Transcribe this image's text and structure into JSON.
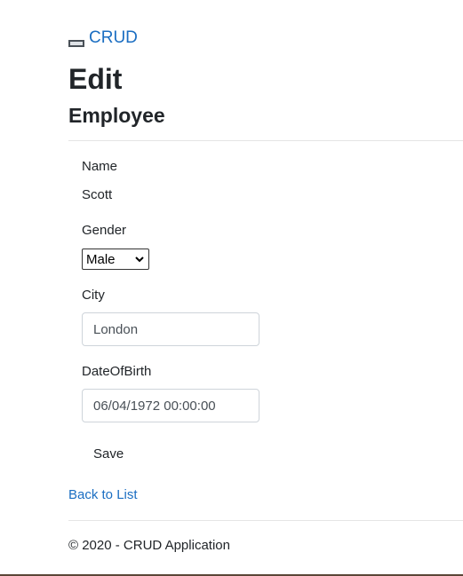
{
  "header": {
    "brand_text": "CRUD"
  },
  "page": {
    "title": "Edit",
    "subtitle": "Employee"
  },
  "form": {
    "name_label": "Name",
    "name_value": "Scott",
    "gender_label": "Gender",
    "gender_selected": "Male",
    "city_label": "City",
    "city_value": "London",
    "dob_label": "DateOfBirth",
    "dob_value": "06/04/1972 00:00:00",
    "save_label": "Save"
  },
  "links": {
    "back_to_list": "Back to List"
  },
  "footer": {
    "text": "© 2020 - CRUD Application"
  },
  "colors": {
    "link": "#1b6ec2",
    "text": "#212529",
    "divider": "#e5e5e5",
    "input_border": "#ced4da"
  },
  "icons": {
    "brand": "broken-image-icon",
    "select": "chevron-down-icon"
  }
}
